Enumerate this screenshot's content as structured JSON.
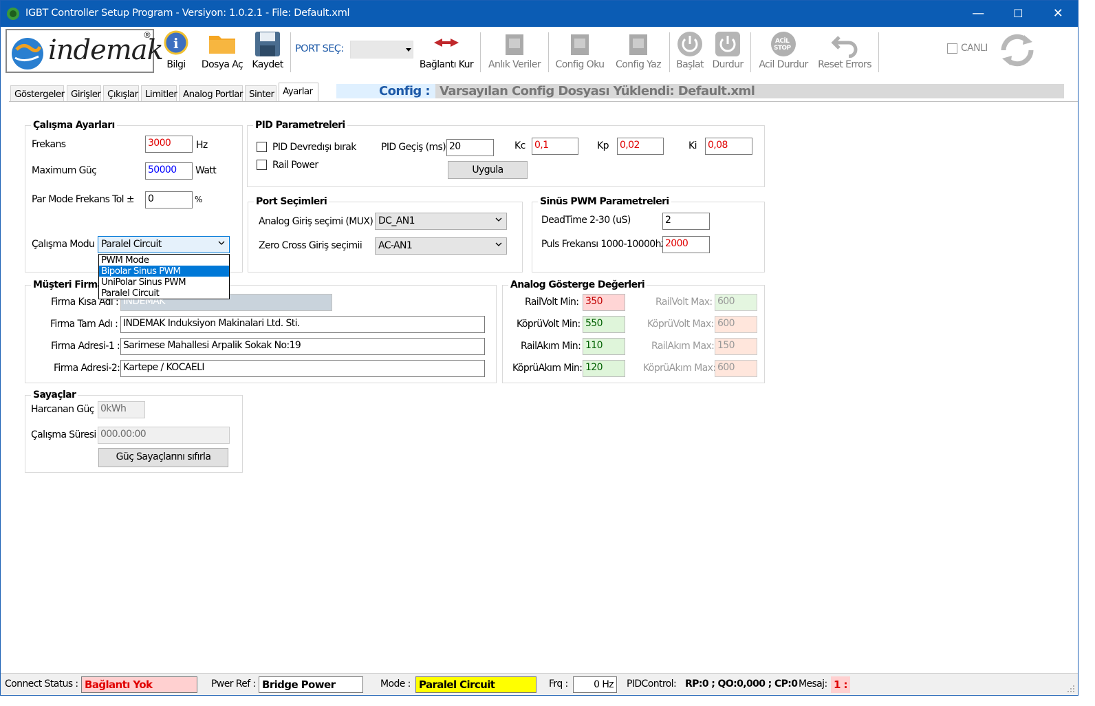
{
  "window": {
    "title": "IGBT Controller Setup Program  -  Versiyon: 1.0.2.1  -  File: Default.xml",
    "min": "—",
    "max": "☐",
    "close": "✕"
  },
  "toolbar": {
    "logo": "indemak",
    "bilgi": "Bilgi",
    "dosya_ac": "Dosya Aç",
    "kaydet": "Kaydet",
    "port_sec_label": "PORT SEÇ:",
    "port_value": "",
    "baglanti_kur": "Bağlantı Kur",
    "anlik_veriler": "Anlık Veriler",
    "config_oku": "Config Oku",
    "config_yaz": "Config Yaz",
    "baslat": "Başlat",
    "durdur": "Durdur",
    "acil_durdur": "Acil Durdur",
    "reset_errors": "Reset Errors",
    "canli": "CANLI"
  },
  "tabs": [
    "Göstergeler",
    "Girişler",
    "Çıkışlar",
    "Limitler",
    "Analog Portlar",
    "Sinter",
    "Ayarlar"
  ],
  "config_bar": {
    "label": "Config :",
    "value": "Varsayılan Config Dosyası Yüklendi: Default.xml"
  },
  "calisma": {
    "title": "Çalışma Ayarları",
    "frekans_label": "Frekans",
    "frekans_value": "3000",
    "frekans_unit": "Hz",
    "guc_label": "Maximum Güç",
    "guc_value": "50000",
    "guc_unit": "Watt",
    "tol_label": "Par Mode Frekans Tol ±",
    "tol_value": "0",
    "tol_unit": "%",
    "mod_label": "Çalışma Modu",
    "mod_value": "Paralel Circuit",
    "mod_options": [
      "PWM Mode",
      "Bipolar Sinus PWM",
      "UniPolar Sinus PWM",
      "Paralel Circuit"
    ]
  },
  "pid": {
    "title": "PID Parametreleri",
    "devredisi": "PID Devredışı bırak",
    "rail_power": "Rail Power",
    "gecis_label": "PID Geçiş (ms)",
    "gecis_value": "20",
    "kc_label": "Kc",
    "kc_value": "0,1",
    "kp_label": "Kp",
    "kp_value": "0,02",
    "ki_label": "Ki",
    "ki_value": "0,08",
    "uygula": "Uygula"
  },
  "port": {
    "title": "Port Seçimleri",
    "analog_label": "Analog Giriş seçimi (MUX)",
    "analog_value": "DC_AN1",
    "zero_label": "Zero Cross Giriş seçimii",
    "zero_value": "AC-AN1"
  },
  "sinus": {
    "title": "Sinüs PWM Parametreleri",
    "dead_label": "DeadTime  2-30 (uS)",
    "dead_value": "2",
    "puls_label": "Puls Frekansı 1000-10000hz",
    "puls_value": "2000"
  },
  "musteri": {
    "title": "Müşteri Firma",
    "kisa_label": "Firma Kısa Adı :",
    "kisa_value": "INDEMAK",
    "tam_label": "Firma Tam Adı :",
    "tam_value": "INDEMAK Induksiyon Makinalari Ltd. Sti.",
    "adres1_label": "Firma Adresi-1 :",
    "adres1_value": "Sarimese Mahallesi Arpalik Sokak No:19",
    "adres2_label": "Firma Adresi-2:",
    "adres2_value": "Kartepe / KOCAELI"
  },
  "analog": {
    "title": "Analog Gösterge Değerleri",
    "railvolt_min_label": "RailVolt Min:",
    "railvolt_min": "350",
    "railvolt_max_label": "RailVolt Max:",
    "railvolt_max": "600",
    "koprivolt_min_label": "KöprüVolt Min:",
    "koprivolt_min": "550",
    "koprivolt_max_label": "KöprüVolt Max:",
    "koprivolt_max": "600",
    "railakim_min_label": "RailAkım Min:",
    "railakim_min": "110",
    "railakim_max_label": "RailAkım Max:",
    "railakim_max": "150",
    "kopruakim_min_label": "KöprüAkım Min:",
    "kopruakim_min": "120",
    "kopruakim_max_label": "KöprüAkım Max:",
    "kopruakim_max": "600"
  },
  "sayaclar": {
    "title": "Sayaçlar",
    "harcanan_label": "Harcanan Güç",
    "harcanan_value": "0kWh",
    "sure_label": "Çalışma Süresi",
    "sure_value": "000.00:00",
    "reset": "Güç Sayaçlarını sıfırla"
  },
  "status": {
    "connect_label": "Connect Status :",
    "connect_value": "Bağlantı Yok",
    "pwer_label": "Pwer Ref :",
    "pwer_value": "Bridge Power",
    "mode_label": "Mode :",
    "mode_value": "Paralel Circuit",
    "frq_label": "Frq :",
    "frq_value": "0 Hz",
    "pid_label": "PIDControl:",
    "pid_value": "RP:0 ; QO:0,000 ; CP:0",
    "mesaj_label": "Mesaj:",
    "mesaj_value": "1 :"
  },
  "colors": {
    "titlebar": "#0b5cb4",
    "red_text": "#e00000",
    "blue_text": "#0000ff",
    "pink_bg": "#ffd5d5",
    "green_bg": "#dff5da",
    "yellow_bg": "#ffff00",
    "config_blue": "#1e5aa8"
  }
}
